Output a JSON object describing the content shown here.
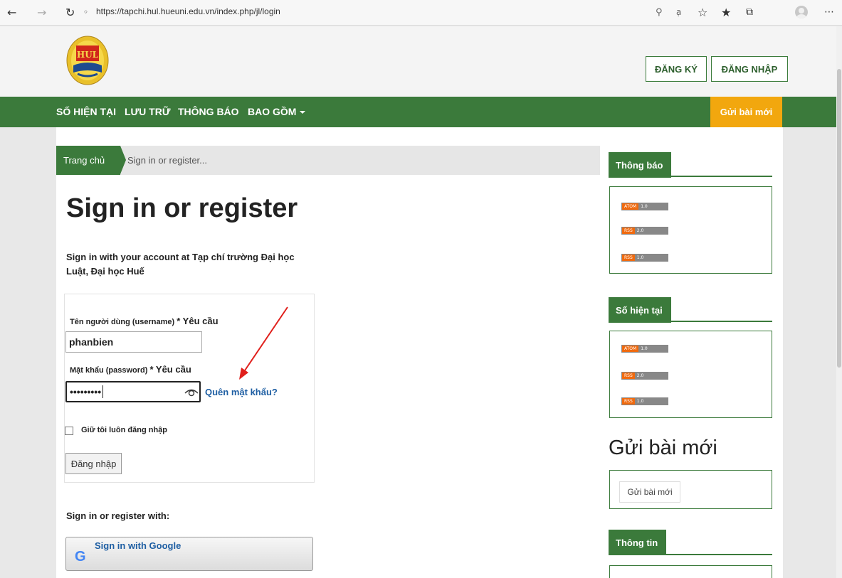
{
  "browser": {
    "url": "https://tapchi.hul.hueuni.edu.vn/index.php/jl/login",
    "icons": [
      "back-icon",
      "forward-icon",
      "refresh-icon",
      "site-info-icon",
      "key-icon",
      "read-aloud-icon",
      "add-favorite-icon",
      "favorites-icon",
      "collections-icon",
      "profile-icon",
      "more-icon"
    ]
  },
  "header": {
    "register_label": "ĐĂNG KÝ",
    "login_label": "ĐĂNG NHẬP"
  },
  "nav": {
    "items": [
      "SỐ HIỆN TẠI",
      "LƯU TRỮ",
      "THÔNG BÁO",
      "BAO GỒM"
    ],
    "submit_label": "Gửi bài mới",
    "color": "#3b7a3b",
    "accent": "#f2a70e"
  },
  "breadcrumb": {
    "home": "Trang chủ",
    "current": "Sign in or register..."
  },
  "main": {
    "title": "Sign in or register",
    "intro": "Sign in with your account at Tạp chí trường Đại học Luật, Đại học Huế",
    "username_label": "Tên người dùng (username)",
    "password_label": "Mật khẩu (password)",
    "required_text": "* Yêu cầu",
    "username_value": "phanbien",
    "password_value": "•••••••••",
    "forgot_label": "Quên mật khẩu?",
    "remember_label": "Giữ tôi luôn đăng nhập",
    "login_button": "Đăng nhập",
    "register_with": "Sign in or register with:",
    "google_label": "Sign in with Google"
  },
  "sidebar": {
    "notifications_title": "Thông báo",
    "current_issue_title": "Số hiện tại",
    "feeds": [
      {
        "type": "ATOM",
        "version": "1.0"
      },
      {
        "type": "RSS",
        "version": "2.0"
      },
      {
        "type": "RSS",
        "version": "1.0"
      }
    ],
    "submit_heading": "Gửi bài mới",
    "submit_button": "Gửi bài mới",
    "info_title": "Thông tin"
  }
}
